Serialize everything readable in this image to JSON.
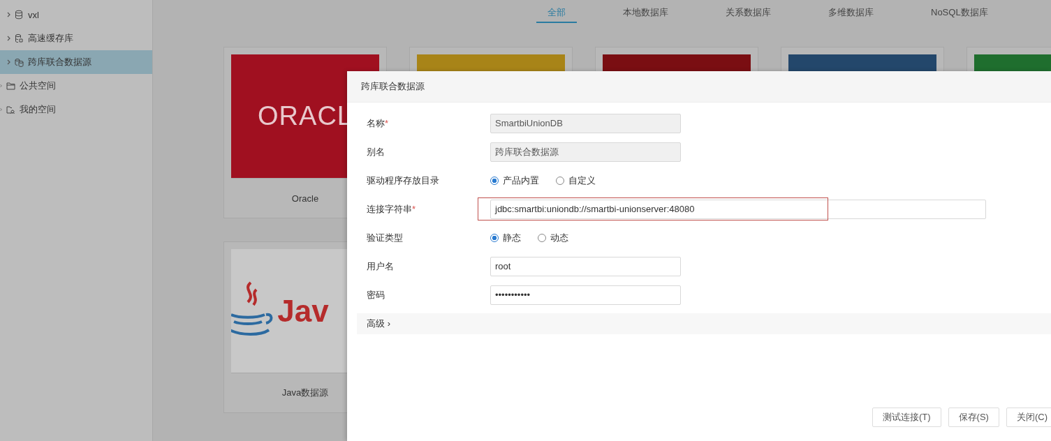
{
  "sidebar": {
    "items": [
      {
        "label": "vxl",
        "kind": "database",
        "selected": false
      },
      {
        "label": "高速缓存库",
        "kind": "cache",
        "selected": false
      },
      {
        "label": "跨库联合数据源",
        "kind": "union",
        "selected": true
      },
      {
        "label": "公共空间",
        "kind": "folder",
        "selected": false
      },
      {
        "label": "我的空间",
        "kind": "personal",
        "selected": false
      }
    ]
  },
  "tabs": [
    {
      "label": "全部",
      "selected": true
    },
    {
      "label": "本地数据库",
      "selected": false
    },
    {
      "label": "关系数据库",
      "selected": false
    },
    {
      "label": "多维数据库",
      "selected": false
    },
    {
      "label": "NoSQL数据库",
      "selected": false
    }
  ],
  "cards": [
    {
      "logo": "ORACL",
      "label": "Oracle",
      "kind": "oracle",
      "color": "#a01020"
    },
    {
      "kind": "plain",
      "color": "#a88418"
    },
    {
      "kind": "plain",
      "color": "#7a0e12"
    },
    {
      "kind": "plain",
      "color": "#23476b"
    },
    {
      "kind": "plain",
      "color": "#1f6e2e"
    },
    {
      "logo": "Jav",
      "label": "Java数据源",
      "kind": "java",
      "color": "#c8c8c8"
    }
  ],
  "dialog": {
    "title": "跨库联合数据源",
    "fields": [
      {
        "label": "名称",
        "required_mark": "*",
        "kind": "text",
        "value": "SmartbiUnionDB",
        "disabled": true
      },
      {
        "label": "别名",
        "kind": "text",
        "value": "跨库联合数据源",
        "disabled": true
      },
      {
        "label": "驱动程序存放目录",
        "kind": "radio",
        "options": [
          {
            "label": "产品内置",
            "selected": true
          },
          {
            "label": "自定义",
            "selected": false
          }
        ]
      },
      {
        "label": "连接字符串",
        "required_mark": "*",
        "kind": "wide",
        "value": "jdbc:smartbi:uniondb://smartbi-unionserver:48080",
        "highlighted": true,
        "disabled": false
      },
      {
        "label": "验证类型",
        "kind": "radio",
        "options": [
          {
            "label": "静态",
            "selected": true
          },
          {
            "label": "动态",
            "selected": false
          }
        ]
      },
      {
        "label": "用户名",
        "kind": "text",
        "value": "root",
        "disabled": false
      },
      {
        "label": "密码",
        "kind": "text",
        "value": "•••••••••••",
        "disabled": false
      }
    ],
    "advanced": {
      "label": "高级",
      "chevron": "›"
    },
    "buttons": [
      "测试连接(T)",
      "保存(S)",
      "关闭(C)"
    ]
  }
}
